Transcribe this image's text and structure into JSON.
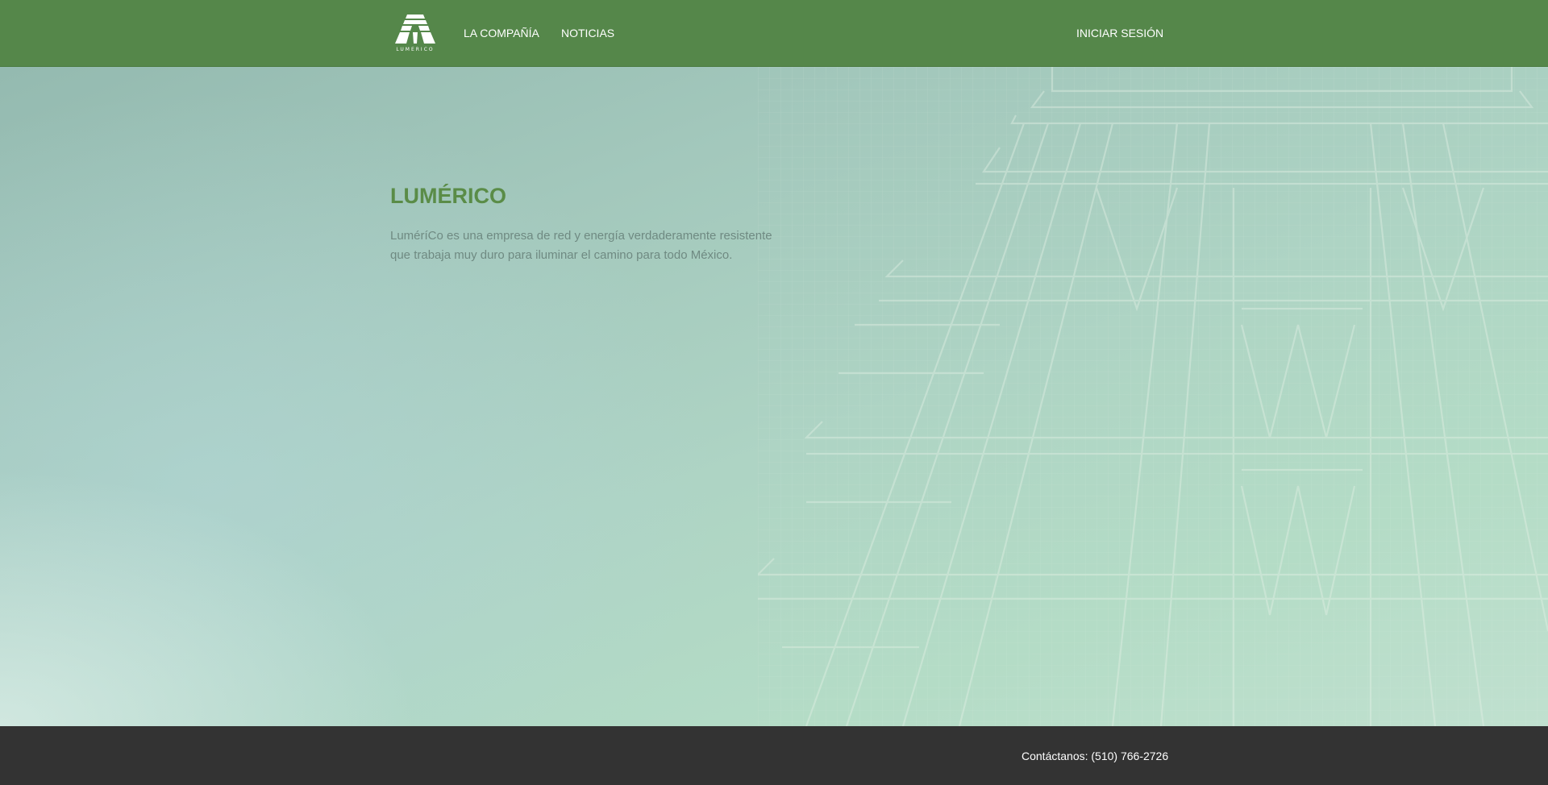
{
  "header": {
    "logo_text": "LUMERICO",
    "nav": {
      "company": "LA COMPAÑÍA",
      "news": "NOTICIAS",
      "login": "INICIAR SESIÓN"
    }
  },
  "hero": {
    "title": "LUMÉRICO",
    "description": "LuméríCo es una empresa de red y energía verdaderamente resistente que trabaja muy duro para iluminar el camino para todo México."
  },
  "footer": {
    "contact": "Contáctanos: (510) 766-2726"
  },
  "colors": {
    "header_bg": "#55874a",
    "title": "#5a8c47",
    "body_text": "#6f8a82",
    "footer_bg": "#333333"
  }
}
